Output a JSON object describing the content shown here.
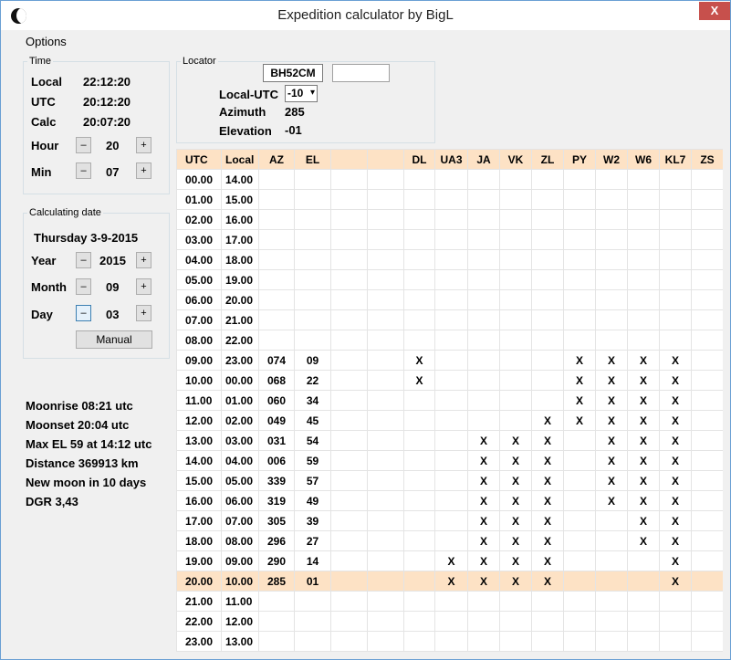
{
  "window": {
    "title": "Expedition calculator by BigL",
    "close_label": "X"
  },
  "menu": {
    "options": "Options"
  },
  "time": {
    "legend": "Time",
    "local_label": "Local",
    "local_value": "22:12:20",
    "utc_label": "UTC",
    "utc_value": "20:12:20",
    "calc_label": "Calc",
    "calc_value": "20:07:20",
    "hour_label": "Hour",
    "hour_value": "20",
    "min_label": "Min",
    "min_value": "07",
    "minus": "–",
    "plus": "+"
  },
  "date": {
    "legend": "Calculating date",
    "display": "Thursday 3-9-2015",
    "year_label": "Year",
    "year_value": "2015",
    "month_label": "Month",
    "month_value": "09",
    "day_label": "Day",
    "day_value": "03",
    "manual_label": "Manual"
  },
  "locator": {
    "legend": "Locator",
    "value": "BH52CM",
    "second_value": "",
    "local_utc_label": "Local-UTC",
    "local_utc_value": "-10",
    "azimuth_label": "Azimuth",
    "azimuth_value": "285",
    "elevation_label": "Elevation",
    "elevation_value": "-01"
  },
  "moon": {
    "moonrise": "Moonrise 08:21 utc",
    "moonset": "Moonset 20:04 utc",
    "max_el": "Max EL 59 at 14:12 utc",
    "distance": "Distance 369913 km",
    "new_moon": "New moon in 10 days",
    "dgr": "DGR 3,43"
  },
  "grid": {
    "headers": [
      "UTC",
      "Local",
      "AZ",
      "EL",
      "",
      "",
      "DL",
      "UA3",
      "JA",
      "VK",
      "ZL",
      "PY",
      "W2",
      "W6",
      "KL7",
      "ZS"
    ],
    "current_row": 20,
    "rows": [
      [
        "00.00",
        "14.00",
        "",
        "",
        "",
        "",
        "",
        "",
        "",
        "",
        "",
        "",
        "",
        "",
        "",
        ""
      ],
      [
        "01.00",
        "15.00",
        "",
        "",
        "",
        "",
        "",
        "",
        "",
        "",
        "",
        "",
        "",
        "",
        "",
        ""
      ],
      [
        "02.00",
        "16.00",
        "",
        "",
        "",
        "",
        "",
        "",
        "",
        "",
        "",
        "",
        "",
        "",
        "",
        ""
      ],
      [
        "03.00",
        "17.00",
        "",
        "",
        "",
        "",
        "",
        "",
        "",
        "",
        "",
        "",
        "",
        "",
        "",
        ""
      ],
      [
        "04.00",
        "18.00",
        "",
        "",
        "",
        "",
        "",
        "",
        "",
        "",
        "",
        "",
        "",
        "",
        "",
        ""
      ],
      [
        "05.00",
        "19.00",
        "",
        "",
        "",
        "",
        "",
        "",
        "",
        "",
        "",
        "",
        "",
        "",
        "",
        ""
      ],
      [
        "06.00",
        "20.00",
        "",
        "",
        "",
        "",
        "",
        "",
        "",
        "",
        "",
        "",
        "",
        "",
        "",
        ""
      ],
      [
        "07.00",
        "21.00",
        "",
        "",
        "",
        "",
        "",
        "",
        "",
        "",
        "",
        "",
        "",
        "",
        "",
        ""
      ],
      [
        "08.00",
        "22.00",
        "",
        "",
        "",
        "",
        "",
        "",
        "",
        "",
        "",
        "",
        "",
        "",
        "",
        ""
      ],
      [
        "09.00",
        "23.00",
        "074",
        "09",
        "",
        "",
        "X",
        "",
        "",
        "",
        "",
        "X",
        "X",
        "X",
        "X",
        ""
      ],
      [
        "10.00",
        "00.00",
        "068",
        "22",
        "",
        "",
        "X",
        "",
        "",
        "",
        "",
        "X",
        "X",
        "X",
        "X",
        ""
      ],
      [
        "11.00",
        "01.00",
        "060",
        "34",
        "",
        "",
        "",
        "",
        "",
        "",
        "",
        "X",
        "X",
        "X",
        "X",
        ""
      ],
      [
        "12.00",
        "02.00",
        "049",
        "45",
        "",
        "",
        "",
        "",
        "",
        "",
        "X",
        "X",
        "X",
        "X",
        "X",
        ""
      ],
      [
        "13.00",
        "03.00",
        "031",
        "54",
        "",
        "",
        "",
        "",
        "X",
        "X",
        "X",
        "",
        "X",
        "X",
        "X",
        ""
      ],
      [
        "14.00",
        "04.00",
        "006",
        "59",
        "",
        "",
        "",
        "",
        "X",
        "X",
        "X",
        "",
        "X",
        "X",
        "X",
        ""
      ],
      [
        "15.00",
        "05.00",
        "339",
        "57",
        "",
        "",
        "",
        "",
        "X",
        "X",
        "X",
        "",
        "X",
        "X",
        "X",
        ""
      ],
      [
        "16.00",
        "06.00",
        "319",
        "49",
        "",
        "",
        "",
        "",
        "X",
        "X",
        "X",
        "",
        "X",
        "X",
        "X",
        ""
      ],
      [
        "17.00",
        "07.00",
        "305",
        "39",
        "",
        "",
        "",
        "",
        "X",
        "X",
        "X",
        "",
        "",
        "X",
        "X",
        ""
      ],
      [
        "18.00",
        "08.00",
        "296",
        "27",
        "",
        "",
        "",
        "",
        "X",
        "X",
        "X",
        "",
        "",
        "X",
        "X",
        ""
      ],
      [
        "19.00",
        "09.00",
        "290",
        "14",
        "",
        "",
        "",
        "X",
        "X",
        "X",
        "X",
        "",
        "",
        "",
        "X",
        ""
      ],
      [
        "20.00",
        "10.00",
        "285",
        "01",
        "",
        "",
        "",
        "X",
        "X",
        "X",
        "X",
        "",
        "",
        "",
        "X",
        ""
      ],
      [
        "21.00",
        "11.00",
        "",
        "",
        "",
        "",
        "",
        "",
        "",
        "",
        "",
        "",
        "",
        "",
        "",
        ""
      ],
      [
        "22.00",
        "12.00",
        "",
        "",
        "",
        "",
        "",
        "",
        "",
        "",
        "",
        "",
        "",
        "",
        "",
        ""
      ],
      [
        "23.00",
        "13.00",
        "",
        "",
        "",
        "",
        "",
        "",
        "",
        "",
        "",
        "",
        "",
        "",
        "",
        ""
      ]
    ]
  }
}
